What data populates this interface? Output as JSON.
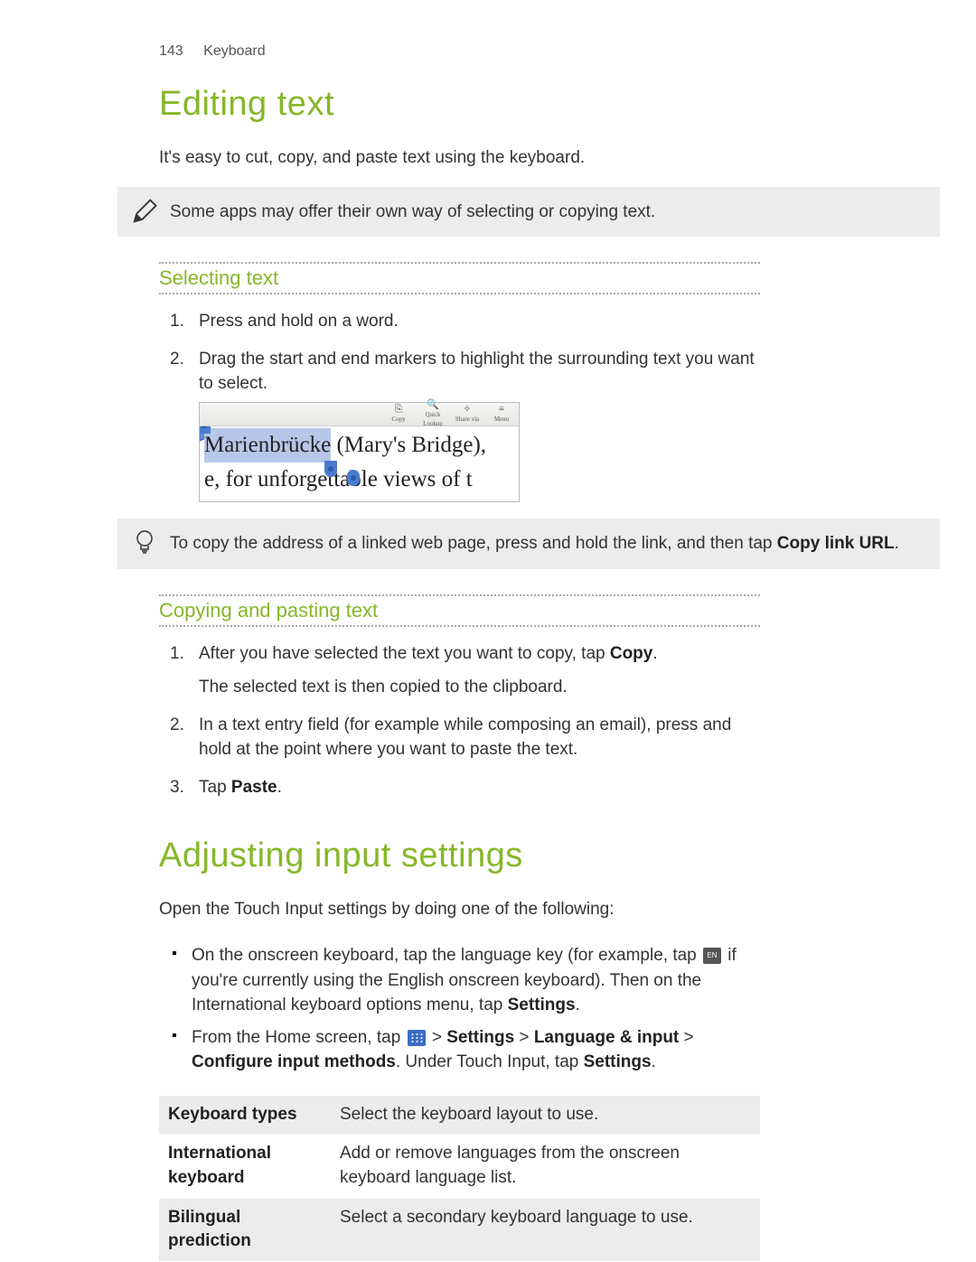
{
  "header": {
    "page_number": "143",
    "chapter": "Keyboard"
  },
  "section1": {
    "title": "Editing text",
    "intro": "It's easy to cut, copy, and paste text using the keyboard.",
    "note1": "Some apps may offer their own way of selecting or copying text.",
    "sub1_title": "Selecting text",
    "step1": "Press and hold on a word.",
    "step2": "Drag the start and end markers to highlight the surrounding text you want to select.",
    "screenshot": {
      "toolbar": {
        "copy": "Copy",
        "lookup": "Quick Lookup",
        "share": "Share via",
        "menu": "Menu"
      },
      "highlighted": "Marienbrücke",
      "line1_rest": " (Mary's Bridge),",
      "line2": "e, for unforgettable views of t"
    },
    "tip_pre": "To copy the address of a linked web page, press and hold the link, and then tap ",
    "tip_bold": "Copy link URL",
    "tip_post": ".",
    "sub2_title": "Copying and pasting text",
    "copy_step1_pre": "After you have selected the text you want to copy, tap ",
    "copy_step1_bold": "Copy",
    "copy_step1_post": ".",
    "copy_step1_sub": "The selected text is then copied to the clipboard.",
    "copy_step2": "In a text entry field (for example while composing an email), press and hold at the point where you want to paste the text.",
    "copy_step3_pre": "Tap ",
    "copy_step3_bold": "Paste",
    "copy_step3_post": "."
  },
  "section2": {
    "title": "Adjusting input settings",
    "intro": "Open the Touch Input settings by doing one of the following:",
    "bullet1_a": "On the onscreen keyboard, tap the language key (for example, tap ",
    "bullet1_key": "EN",
    "bullet1_b": " if you're currently using the English onscreen keyboard). Then on the International keyboard options menu, tap ",
    "bullet1_bold": "Settings",
    "bullet1_post": ".",
    "bullet2_a": "From the Home screen, tap ",
    "bullet2_b": " > ",
    "bullet2_s1": "Settings",
    "bullet2_s2": "Language & input",
    "bullet2_s3": "Configure input methods",
    "bullet2_c": ". Under Touch Input, tap ",
    "bullet2_s4": "Settings",
    "table": {
      "r1_label": "Keyboard types",
      "r1_desc": "Select the keyboard layout to use.",
      "r2_label": "International keyboard",
      "r2_desc": "Add or remove languages from the onscreen keyboard language list.",
      "r3_label": "Bilingual prediction",
      "r3_desc": "Select a secondary keyboard language to use."
    }
  }
}
